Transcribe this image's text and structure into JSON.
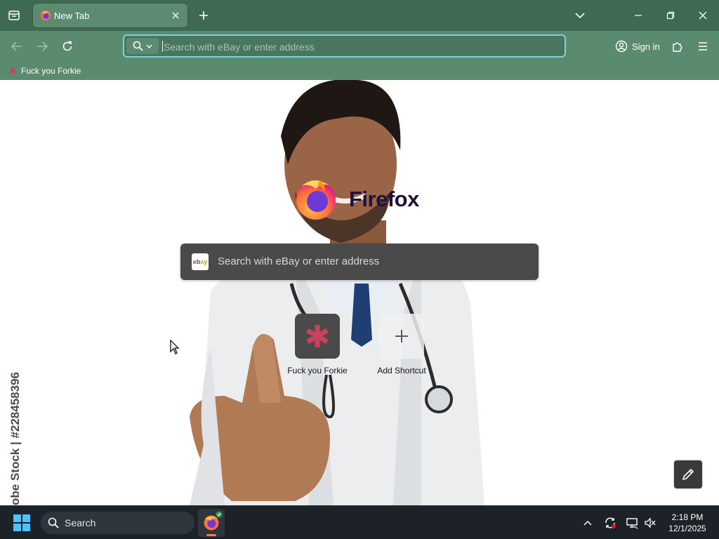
{
  "browser": {
    "tab": {
      "title": "New Tab"
    },
    "urlbar": {
      "placeholder": "Search with eBay or enter address"
    },
    "signin_label": "Sign in",
    "bookmarks": [
      {
        "label": "Fuck you Forkie"
      }
    ]
  },
  "newtab": {
    "brand": "Firefox",
    "search_placeholder": "Search with eBay or enter address",
    "search_engine_icon": "ebay",
    "shortcuts": [
      {
        "label": "Fuck you Forkie",
        "icon": "asterisk-icon"
      },
      {
        "label": "Add Shortcut",
        "icon": "plus-icon"
      }
    ],
    "background_watermark": "obe Stock | #228458396"
  },
  "taskbar": {
    "search_label": "Search",
    "time": "2:18 PM",
    "date": "12/1/2025"
  },
  "colors": {
    "toolbar": "#5a8b6f",
    "tabstrip": "#3f6a52",
    "urlbar_focus": "#7fd3e0",
    "shortcut_accent": "#c8425f"
  }
}
